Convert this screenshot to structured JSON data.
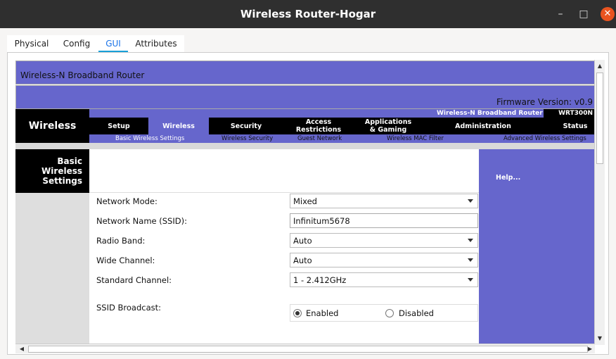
{
  "window": {
    "title": "Wireless Router-Hogar",
    "minimize": "–",
    "maximize": "□",
    "close": "✕"
  },
  "app_tabs": [
    "Physical",
    "Config",
    "GUI",
    "Attributes"
  ],
  "router": {
    "header_title": "Wireless-N Broadband Router",
    "firmware": "Firmware Version: v0.9",
    "product_name": "Wireless-N Broadband Router",
    "model": "WRT300N",
    "section": "Wireless",
    "nav": [
      "Setup",
      "Wireless",
      "Security",
      "Access\nRestrictions",
      "Applications\n& Gaming",
      "Administration",
      "Status"
    ],
    "subnav": [
      "Basic Wireless Settings",
      "Wireless Security",
      "Guest Network",
      "Wireless MAC Filter",
      "Advanced Wireless Settings"
    ],
    "page_title": "Basic\nWireless\nSettings",
    "help": "Help..."
  },
  "form": {
    "network_mode_label": "Network Mode:",
    "network_mode": "Mixed",
    "ssid_label": "Network Name (SSID):",
    "ssid": "Infinitum5678",
    "radio_band_label": "Radio Band:",
    "radio_band": "Auto",
    "wide_channel_label": "Wide Channel:",
    "wide_channel": "Auto",
    "standard_channel_label": "Standard Channel:",
    "standard_channel": "1 - 2.412GHz",
    "ssid_broadcast_label": "SSID Broadcast:",
    "broadcast_enabled": "Enabled",
    "broadcast_disabled": "Disabled"
  },
  "colors": {
    "router_purple": "#6666cc",
    "titlebar": "#2f2f2f",
    "close": "#e95420",
    "tab_accent": "#19a0d8"
  }
}
